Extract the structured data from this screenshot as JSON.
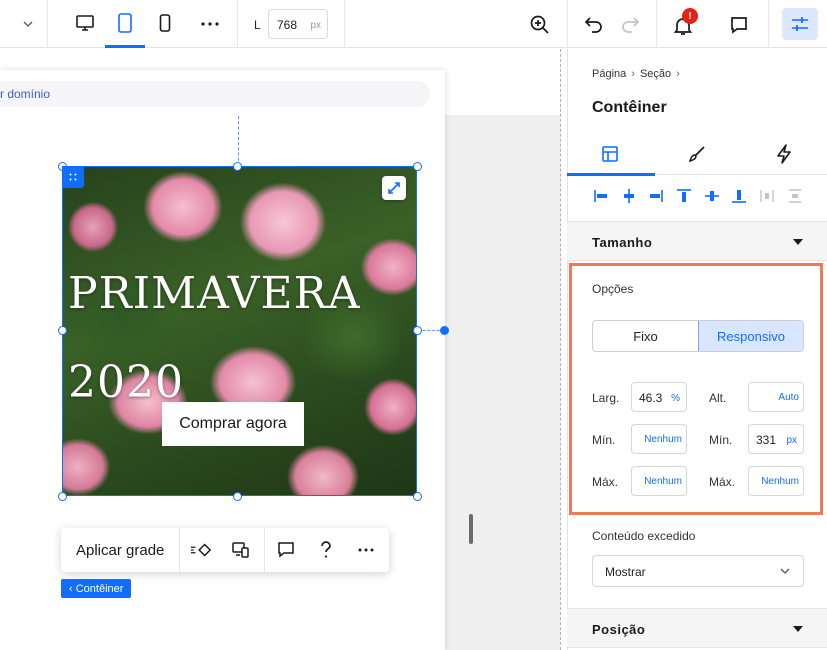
{
  "colors": {
    "accent": "#116dff",
    "highlight": "#ee7a5a",
    "badge": "#e62214"
  },
  "topbar": {
    "width_label": "L",
    "width_value": "768",
    "width_unit": "px",
    "notification_count": "!",
    "icons": [
      "chevron-down-icon",
      "desktop-icon",
      "tablet-icon",
      "mobile-icon",
      "more-icon",
      "zoom-icon",
      "undo-icon",
      "redo-icon",
      "bell-icon",
      "comment-icon",
      "sliders-icon"
    ]
  },
  "canvas": {
    "domain_text": "r domínio",
    "headline_line1": "PRIMAVERA",
    "headline_line2": "2020",
    "cta_label": "Comprar agora",
    "toolbar": {
      "apply_grid": "Aplicar grade"
    },
    "breadcrumb_chip": "‹ Contêiner"
  },
  "panel": {
    "breadcrumb": [
      "Página",
      "Seção"
    ],
    "title": "Contêiner",
    "tabs": [
      "layout-icon",
      "brush-icon",
      "bolt-icon"
    ],
    "size_section": "Tamanho",
    "options_label": "Opções",
    "segments": {
      "fixed": "Fixo",
      "responsive": "Responsivo",
      "selected": "Responsivo"
    },
    "fields": {
      "width_label": "Larg.",
      "width_value": "46.3",
      "width_unit": "%",
      "height_label": "Alt.",
      "height_value": "Auto",
      "min_label_left": "Mín.",
      "min_width": "Nenhum",
      "min_label_right": "Mín.",
      "min_height": "331",
      "min_height_unit": "px",
      "max_label_left": "Máx.",
      "max_width": "Nenhum",
      "max_label_right": "Máx.",
      "max_height": "Nenhum"
    },
    "overflow_label": "Conteúdo excedido",
    "overflow_value": "Mostrar",
    "position_section": "Posição"
  }
}
